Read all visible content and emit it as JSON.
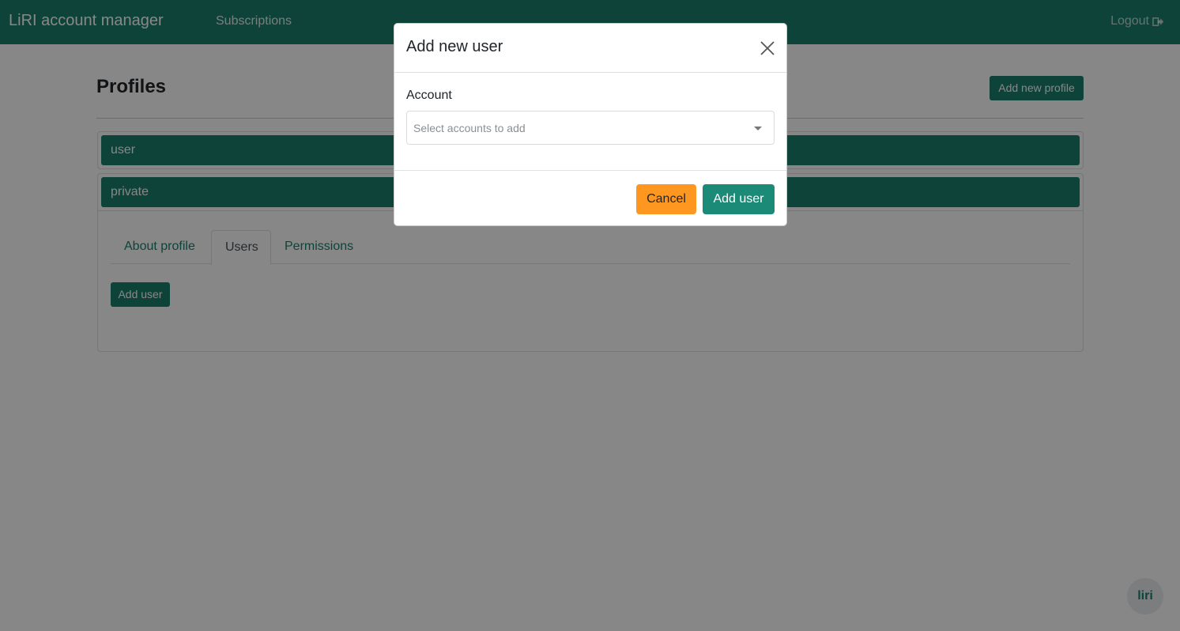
{
  "navbar": {
    "brand": "LiRI account manager",
    "links": [
      "Subscriptions"
    ],
    "logout_label": "Logout",
    "logout_icon": "sign-out-icon",
    "color": "#1b7f6e"
  },
  "page": {
    "title": "Profiles",
    "add_profile_label": "Add new profile",
    "profiles": [
      {
        "name": "user"
      },
      {
        "name": "private"
      }
    ],
    "tabs": [
      "About profile",
      "Users",
      "Permissions"
    ],
    "active_tab": "Users",
    "add_user_label": "Add user"
  },
  "modal": {
    "title": "Add new user",
    "close_icon": "close-icon",
    "account_label": "Account",
    "account_placeholder": "Select accounts to add",
    "cancel_label": "Cancel",
    "submit_label": "Add user",
    "cancel_color": "#fd9720",
    "submit_color": "#1b8a77"
  },
  "badge": {
    "text": "liri",
    "icon": "liri-logo-icon"
  }
}
